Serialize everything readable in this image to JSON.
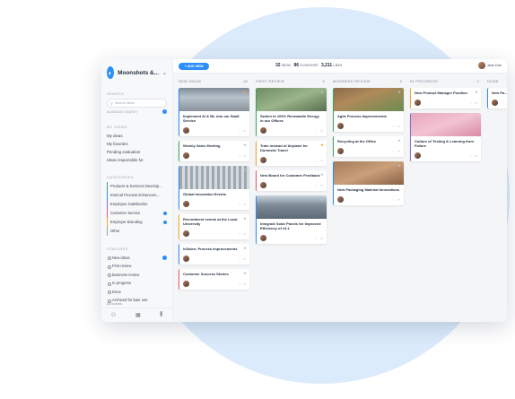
{
  "app": {
    "name": "Moonshots &..."
  },
  "sidebar": {
    "search_label": "SEARCH",
    "search_placeholder": "Search Ideas",
    "advanced": "ADVANCED SEARCH",
    "views_label": "MY VIEWS",
    "views": [
      "My ideas",
      "My favorites",
      "Pending evaluation",
      "Ideas responsible for"
    ],
    "categories_label": "CATEGORIES",
    "categories": [
      {
        "label": "Products & Services Develop...",
        "color": "#3aa55d"
      },
      {
        "label": "Internal Process Enhancem...",
        "color": "#2c8ef8"
      },
      {
        "label": "Employee Satisfaction",
        "color": "#8a6bd1"
      },
      {
        "label": "Customer Service",
        "color": "#e8596b"
      },
      {
        "label": "Employer Branding",
        "color": "#f5a623"
      },
      {
        "label": "Other",
        "color": "#9aa3ae"
      }
    ],
    "statuses_label": "STATUSES",
    "statuses": [
      "New ideas",
      "First review",
      "Business review",
      "In progress",
      "Done",
      "Archived for later use"
    ],
    "all_boards": "All boards"
  },
  "topbar": {
    "add_new": "+ ADD NEW",
    "ideas_count": "32",
    "ideas_label": "Ideas",
    "comments_count": "86",
    "comments_label": "Comments",
    "likes_count": "3,211",
    "likes_label": "Likes",
    "user_name": "Jane Doe"
  },
  "columns": [
    {
      "title": "NEW IDEAS",
      "count": "18",
      "cards": [
        {
          "title": "Implement AI & ML into our SaaS Service",
          "image": "conf",
          "accent": "#2c8ef8",
          "star": "y"
        },
        {
          "title": "Weekly Sales Meeting",
          "image": "",
          "accent": "#3aa55d",
          "star": ""
        },
        {
          "title": "Global Innovation Events",
          "image": "event",
          "accent": "#2c8ef8",
          "star": ""
        },
        {
          "title": "Recruitment events at the Local University",
          "image": "",
          "accent": "#f5a623",
          "star": ""
        },
        {
          "title": "inSales: Process Improvements",
          "image": "",
          "accent": "#2c8ef8",
          "star": ""
        },
        {
          "title": "Customer Success Stories",
          "image": "",
          "accent": "#e8596b",
          "star": ""
        }
      ]
    },
    {
      "title": "FIRST REVIEW",
      "count": "4",
      "cards": [
        {
          "title": "Switch to 100% Renewable Energy in our Offices",
          "image": "green",
          "accent": "#3aa55d",
          "star": ""
        },
        {
          "title": "Train instead of Airplane for Domestic Travel",
          "image": "",
          "accent": "#f5a623",
          "star": "y"
        },
        {
          "title": "New Board for Customer Feedback",
          "image": "",
          "accent": "#e8596b",
          "star": ""
        },
        {
          "title": "Integrate Solar Panels for Improved Efficiency of v3.1",
          "image": "solar",
          "accent": "#2c8ef8",
          "star": ""
        }
      ]
    },
    {
      "title": "BUSINESS REVIEW",
      "count": "3",
      "cards": [
        {
          "title": "Agile Process Improvements",
          "image": "leaves",
          "accent": "#3aa55d",
          "star": ""
        },
        {
          "title": "Recycling at the Office",
          "image": "",
          "accent": "#3aa55d",
          "star": ""
        },
        {
          "title": "New Packaging Material Innovations",
          "image": "pack",
          "accent": "#2c8ef8",
          "star": ""
        }
      ]
    },
    {
      "title": "IN PROGRESS",
      "count": "2",
      "cards": [
        {
          "title": "New Product Manager Position",
          "image": "",
          "accent": "#f5a623",
          "star": ""
        },
        {
          "title": "Culture of Testing & Learning from Failure",
          "image": "pink",
          "accent": "#8a6bd1",
          "star": ""
        }
      ]
    },
    {
      "title": "DONE",
      "count": "",
      "cards": [
        {
          "title": "New Pa...",
          "image": "",
          "accent": "#2c8ef8",
          "star": ""
        }
      ]
    }
  ]
}
